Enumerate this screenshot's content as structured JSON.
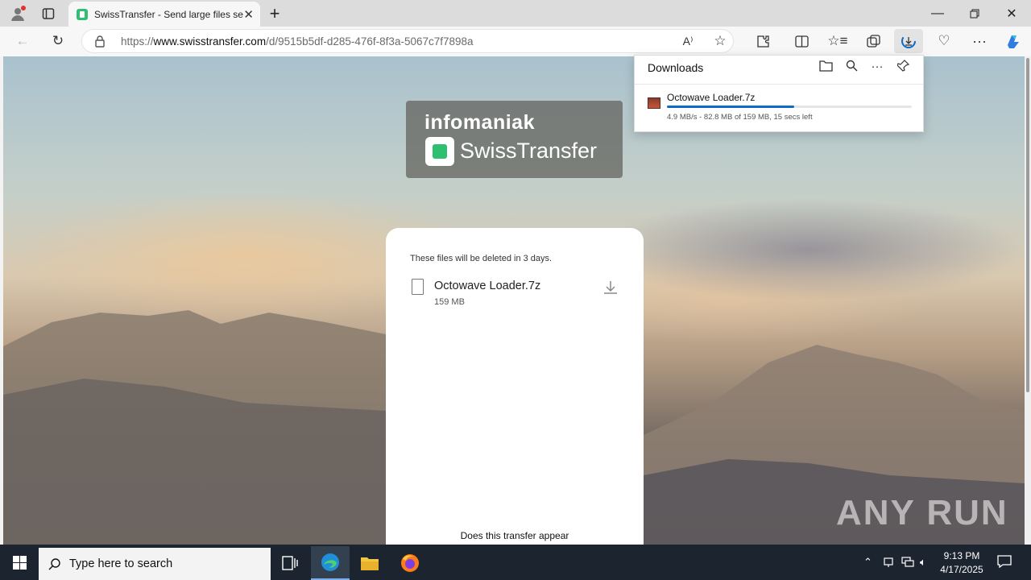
{
  "browser": {
    "tab_title": "SwissTransfer - Send large files se",
    "url_prefix": "https://",
    "url_host": "www.swisstransfer.com",
    "url_path": "/d/9515b5df-d285-476f-8f3a-5067c7f7898a"
  },
  "logo": {
    "brand": "infomaniak",
    "product": "SwissTransfer"
  },
  "transfer_card": {
    "notice": "These files will be deleted in 3 days.",
    "file_name": "Octowave Loader.7z",
    "file_size": "159 MB",
    "bottom_text": "Does this transfer appear"
  },
  "downloads_panel": {
    "title": "Downloads",
    "file_name": "Octowave Loader.7z",
    "status": "4.9 MB/s - 82.8 MB of 159 MB, 15 secs left",
    "progress_fraction": 0.52
  },
  "watermark": "ANY RUN",
  "taskbar": {
    "search_placeholder": "Type here to search",
    "time": "9:13 PM",
    "date": "4/17/2025"
  },
  "colors": {
    "accent": "#0c6bc9",
    "brand_green": "#2fbf71",
    "taskbar": "#1c2430"
  }
}
